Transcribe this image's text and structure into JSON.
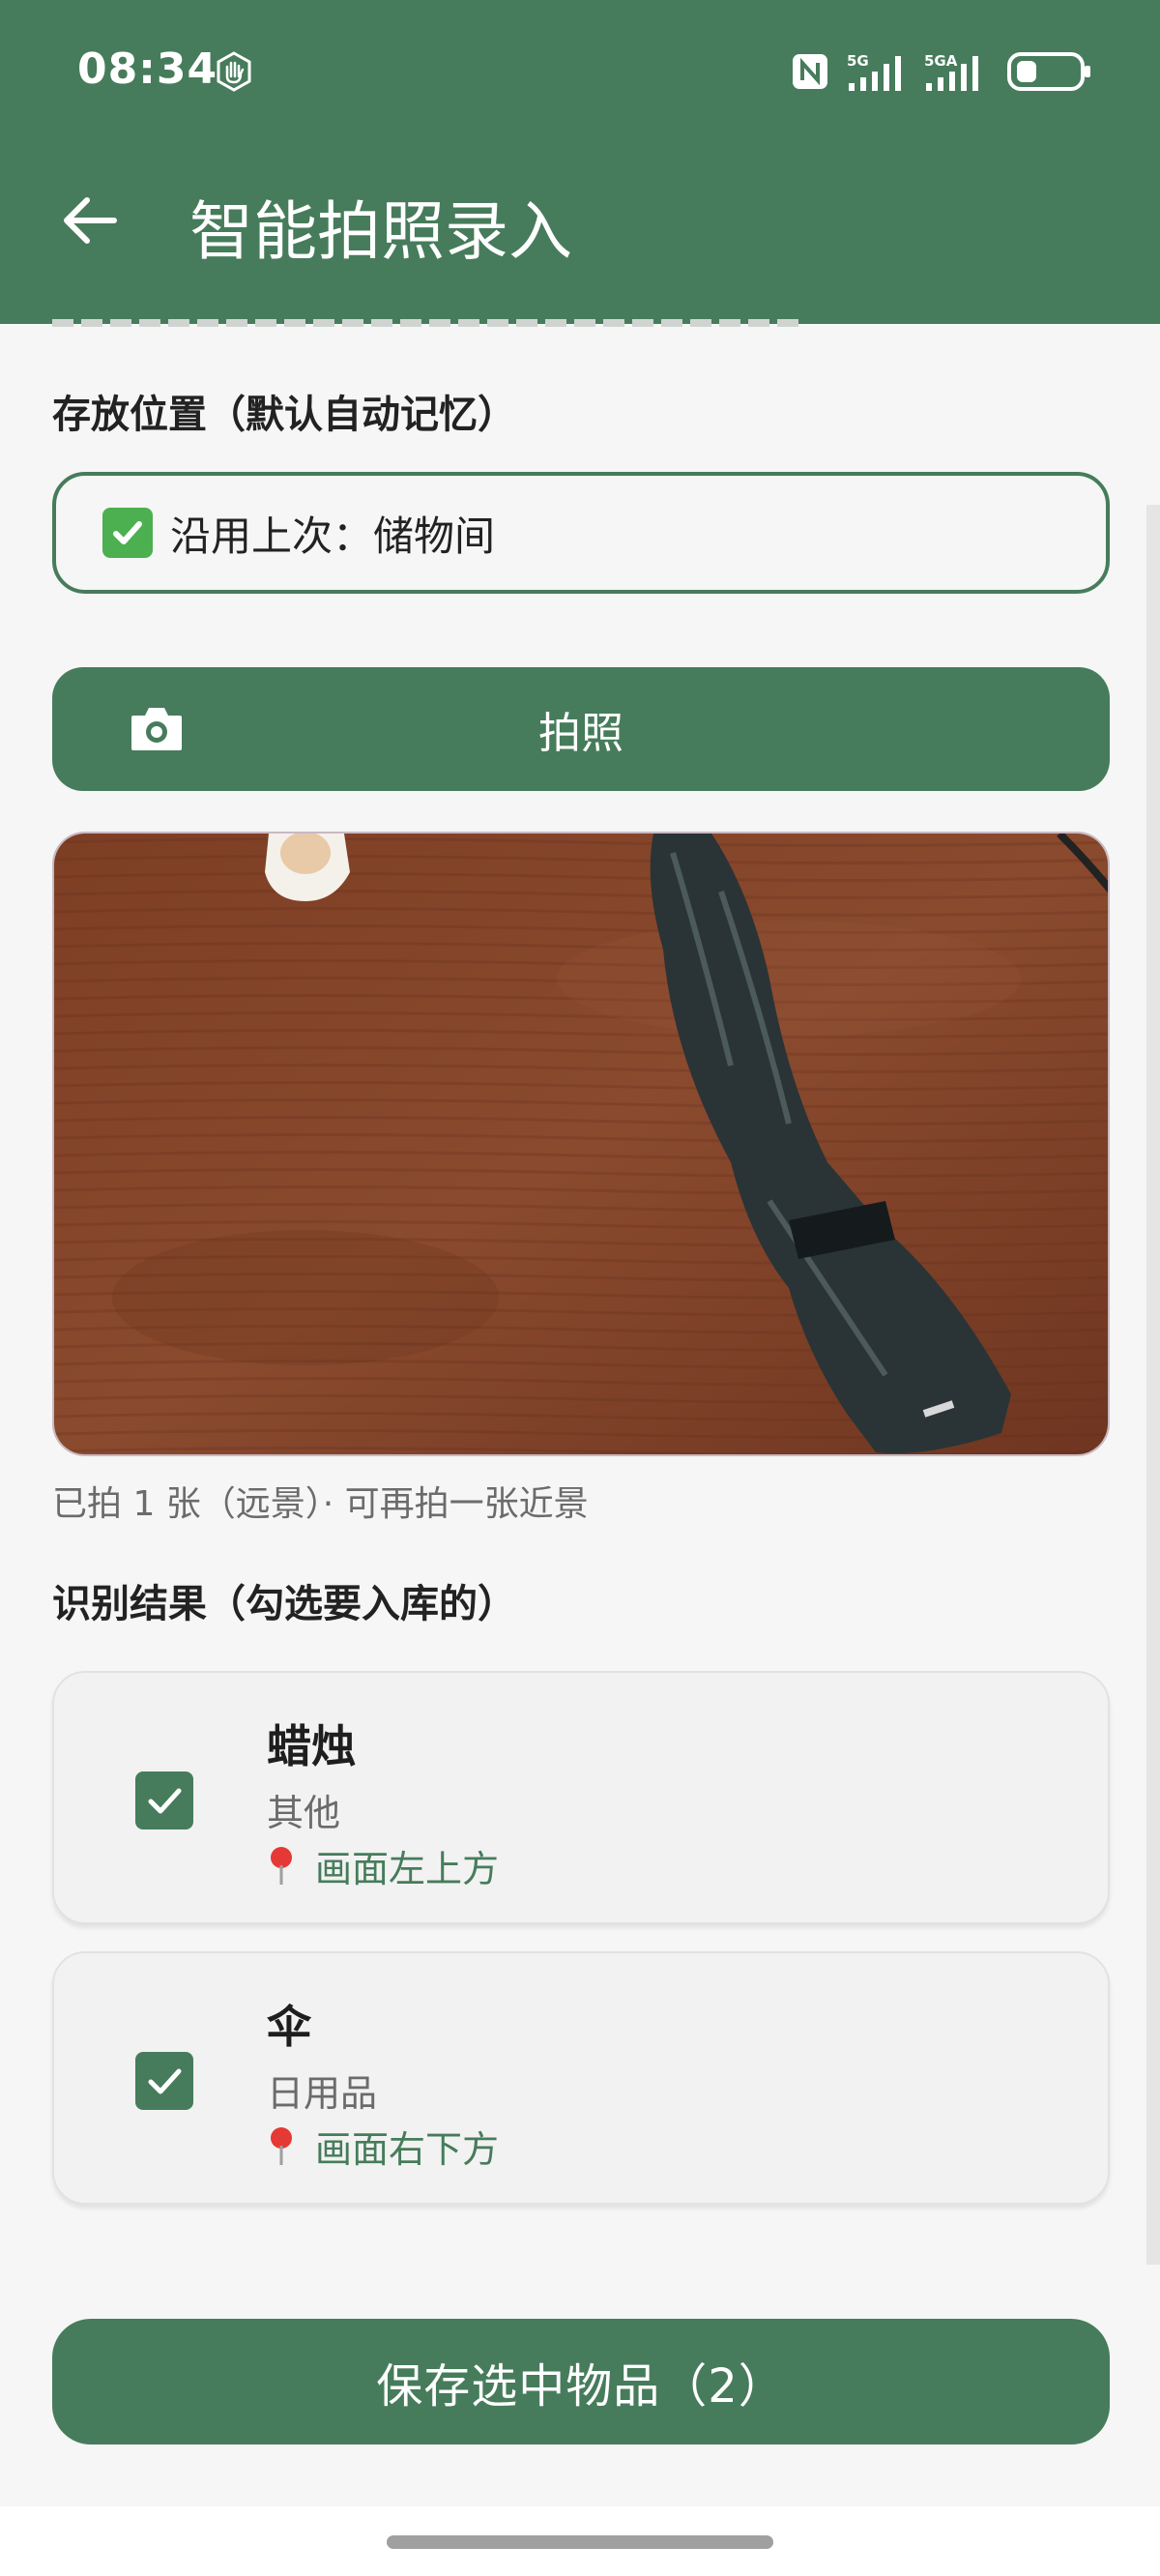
{
  "status_bar": {
    "time": "08:34",
    "signal1_label": "5G",
    "signal2_label": "5GA"
  },
  "header": {
    "title": "智能拍照录入"
  },
  "location": {
    "section_label": "存放位置（默认自动记忆）",
    "value": "沿用上次：储物间"
  },
  "photo": {
    "button_label": "拍照",
    "caption": "已拍 1 张（远景）· 可再拍一张近景"
  },
  "results": {
    "section_label": "识别结果（勾选要入库的）",
    "items": [
      {
        "name": "蜡烛",
        "category": "其他",
        "position": "画面左上方",
        "checked": true
      },
      {
        "name": "伞",
        "category": "日用品",
        "position": "画面右下方",
        "checked": true
      }
    ]
  },
  "save_button": {
    "label": "保存选中物品（2）"
  },
  "colors": {
    "primary": "#467c5b",
    "background": "#f5f6f5",
    "card": "#f2f2f2"
  }
}
